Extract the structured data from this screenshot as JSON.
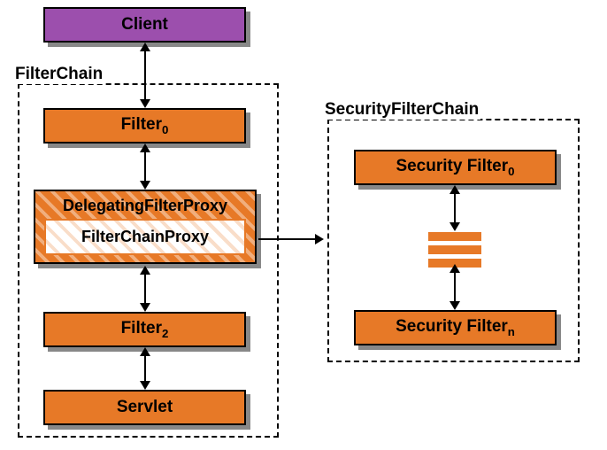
{
  "client": {
    "label": "Client"
  },
  "filterChain": {
    "label": "FilterChain",
    "filter0": {
      "base": "Filter",
      "sub": "0"
    },
    "dfp": {
      "label": "DelegatingFilterProxy"
    },
    "fcp": {
      "label": "FilterChainProxy"
    },
    "filter2": {
      "base": "Filter",
      "sub": "2"
    },
    "servlet": {
      "label": "Servlet"
    }
  },
  "securityFilterChain": {
    "label": "SecurityFilterChain",
    "sf0": {
      "base": "Security Filter",
      "sub": "0"
    },
    "sfn": {
      "base": "Security Filter",
      "sub": "n"
    }
  }
}
